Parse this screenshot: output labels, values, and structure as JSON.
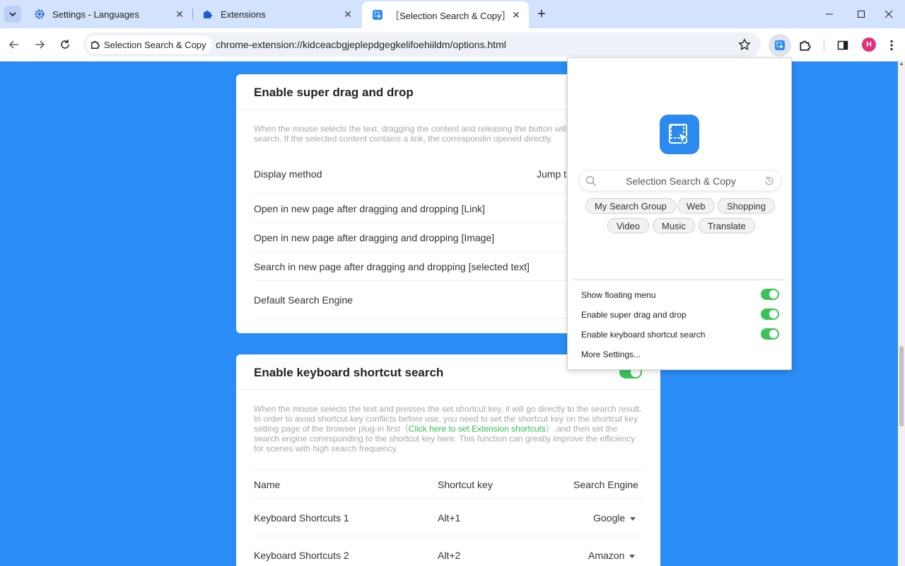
{
  "browser": {
    "tabs": [
      {
        "title": "Settings - Languages",
        "icon": "gear-icon",
        "active": false
      },
      {
        "title": "Extensions",
        "icon": "puzzle-icon",
        "active": false
      },
      {
        "title": "［Selection Search & Copy］",
        "icon": "selection-search-icon",
        "active": true
      }
    ],
    "site_chip": "Selection Search & Copy",
    "url": "chrome-extension://kidceacbgjeplepdgegkelifoehiildm/options.html",
    "avatar_letter": "H"
  },
  "page": {
    "drag_card": {
      "title": "Enable super drag and drop",
      "description": "When the mouse selects the text, dragging the content and releasing the button will engine set below to search. If the selected content contains a link, the correspondin opened directly.",
      "rows": [
        {
          "label": "Display method",
          "value": "Jump t"
        },
        {
          "label": "Open in new page after dragging and dropping [Link]"
        },
        {
          "label": "Open in new page after dragging and dropping [Image]"
        },
        {
          "label": "Search in new page after dragging and dropping [selected text]"
        },
        {
          "label": "Default Search Engine"
        }
      ]
    },
    "shortcut_card": {
      "title": "Enable keyboard shortcut search",
      "enabled": true,
      "description_before": "When the mouse selects the text and presses the set shortcut key, it will go directly to the search result. In order to avoid shortcut key conflicts before use, you need to set the shortcut key on the shortcut key setting page of the browser plug-in first（",
      "description_link": "Click here to set Extension shortcuts",
      "description_after": "）,and then set the search engine corresponding to the shortcut key here. This function can greatly improve the efficiency for scenes with high search frequency.",
      "columns": [
        "Name",
        "Shortcut key",
        "Search Engine"
      ],
      "rows": [
        {
          "name": "Keyboard Shortcuts 1",
          "key": "Alt+1",
          "engine": "Google"
        },
        {
          "name": "Keyboard Shortcuts 2",
          "key": "Alt+2",
          "engine": "Amazon"
        }
      ]
    }
  },
  "popup": {
    "search_placeholder": "Selection Search & Copy",
    "chips": [
      "My Search Group",
      "Web",
      "Shopping",
      "Video",
      "Music",
      "Translate"
    ],
    "settings": [
      {
        "label": "Show floating menu",
        "enabled": true
      },
      {
        "label": "Enable super drag and drop",
        "enabled": true
      },
      {
        "label": "Enable keyboard shortcut search",
        "enabled": true
      }
    ],
    "more_settings": "More Settings..."
  },
  "colors": {
    "page_background": "#2a8cf5",
    "toggle_on": "#3cc25a",
    "link_green": "#2fbe4c",
    "brand_blue": "#2b8af0"
  }
}
